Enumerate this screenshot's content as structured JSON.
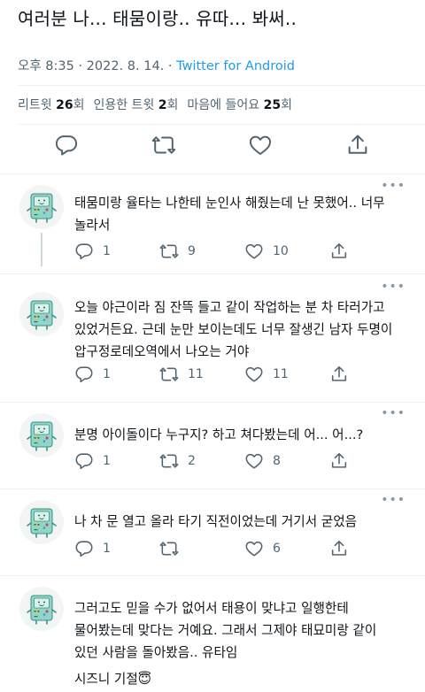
{
  "main": {
    "text": "여러분 나... 태뭄이랑.. 유따... 봐써..",
    "time": "오후 8:35 · 2022. 8. 14. · ",
    "source": "Twitter for Android",
    "stats": {
      "retweets_label": "리트윗",
      "retweets": "26",
      "retweets_unit": "회",
      "quotes_label": "인용한 트윗",
      "quotes": "2",
      "quotes_unit": "회",
      "likes_label": "마음에 들어요",
      "likes": "25",
      "likes_unit": "회"
    },
    "icons": [
      "reply-icon",
      "retweet-icon",
      "like-icon",
      "share-icon"
    ]
  },
  "more_label": "•••",
  "replies": [
    {
      "text": "태뭄미랑 율타는 나한테 눈인사 해줬는데 난 못했어.. 너무 놀라서",
      "reply_count": "1",
      "retweet_count": "9",
      "like_count": "10"
    },
    {
      "text": "오늘 야근이라 짐 잔뜩 들고 같이 작업하는 분 차 타러가고 있었거든요. 근데 눈만 보이는데도 너무 잘생긴 남자 두명이 압구정로데오역에서 나오는 거야",
      "reply_count": "1",
      "retweet_count": "11",
      "like_count": "11"
    },
    {
      "text": "분명 아이돌이다 누구지? 하고 쳐다봤는데 어... 어...?",
      "reply_count": "1",
      "retweet_count": "2",
      "like_count": "8"
    },
    {
      "text": "나 차 문 열고 올라 타기 직전이었는데 거기서 굳었음",
      "reply_count": "1",
      "retweet_count": "",
      "like_count": "6"
    },
    {
      "text": "그러고도 믿을 수가 없어서 태용이 맞냐고 일행한테 물어봤는데 맞다는 거예요. 그래서 그제야 태묘미랑 같이 있던 사람을 돌아봤음.. 유타임",
      "line2": "시즈니 기절",
      "emoji": "😇"
    }
  ],
  "colors": {
    "accent": "#1d9bf0",
    "muted": "#536471",
    "text": "#0f1419",
    "divider": "#eff3f4"
  }
}
